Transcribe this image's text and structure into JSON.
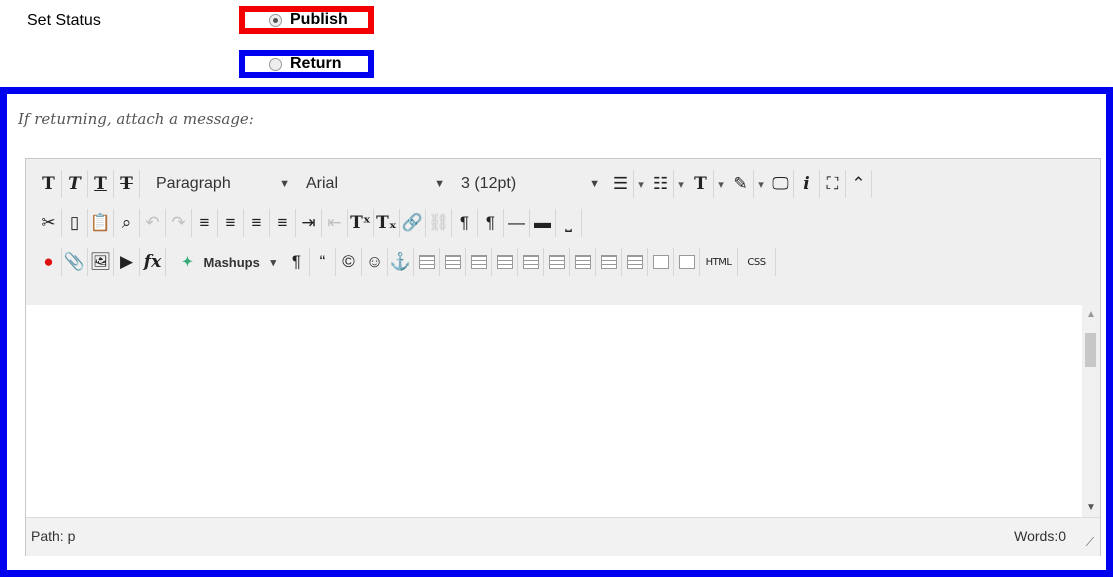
{
  "set_status": {
    "label": "Set Status",
    "options": [
      {
        "label": "Publish",
        "selected": true,
        "highlight": "#f30000"
      },
      {
        "label": "Return",
        "selected": false,
        "highlight": "#0000f0"
      }
    ]
  },
  "message": {
    "prompt": "If returning, attach a message:",
    "panel_border": "#0000f0"
  },
  "editor": {
    "format_dropdown": "Paragraph",
    "font_dropdown": "Arial",
    "size_dropdown": "3 (12pt)",
    "mashups_label": "Mashups",
    "html_label": "HTML",
    "css_label": "CSS",
    "path_text": "Path: p",
    "words_text": "Words:0"
  }
}
